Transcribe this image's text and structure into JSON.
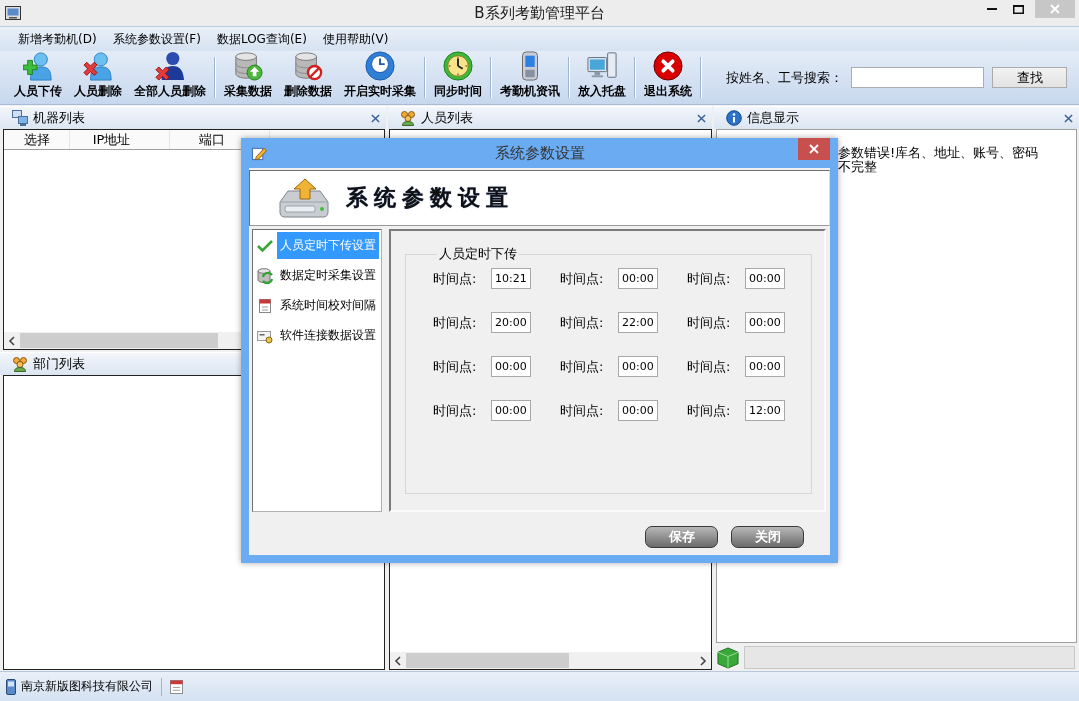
{
  "window": {
    "title": "B系列考勤管理平台"
  },
  "menu": [
    "新增考勤机(D)",
    "系统参数设置(F)",
    "数据LOG查询(E)",
    "使用帮助(V)"
  ],
  "toolbar": [
    {
      "items": [
        {
          "label": "人员下传",
          "kind": "adduser"
        },
        {
          "label": "人员删除",
          "kind": "deluser"
        },
        {
          "label": "全部人员删除",
          "kind": "delall"
        }
      ]
    },
    {
      "items": [
        {
          "label": "采集数据",
          "kind": "collect"
        },
        {
          "label": "删除数据",
          "kind": "erase"
        },
        {
          "label": "开启实时采集",
          "kind": "realtime"
        }
      ]
    },
    {
      "items": [
        {
          "label": "同步时间",
          "kind": "sync"
        }
      ]
    },
    {
      "items": [
        {
          "label": "考勤机资讯",
          "kind": "device"
        }
      ]
    },
    {
      "items": [
        {
          "label": "放入托盘",
          "kind": "tray"
        }
      ]
    },
    {
      "items": [
        {
          "label": "退出系统",
          "kind": "exit"
        }
      ]
    }
  ],
  "search": {
    "label": "按姓名、工号搜索：",
    "button": "查找"
  },
  "machine_list": {
    "title": "机器列表",
    "columns": [
      "选择",
      "IP地址",
      "端口"
    ]
  },
  "department_list": {
    "title": "部门列表"
  },
  "person_list": {
    "title": "人员列表"
  },
  "info_panel": {
    "title": "信息显示",
    "lines": [
      "参数错误!库名、地址、账号、密码",
      "不完整"
    ]
  },
  "status_bar": {
    "company": "南京新版图科技有限公司"
  },
  "dialog": {
    "title": "系统参数设置",
    "heading": "系统参数设置",
    "nav": [
      {
        "label": "人员定时下传设置",
        "kind": "check",
        "selected": true
      },
      {
        "label": "数据定时采集设置",
        "kind": "dbsync",
        "selected": false
      },
      {
        "label": "系统时间校对间隔",
        "kind": "calendar",
        "selected": false
      },
      {
        "label": "软件连接数据设置",
        "kind": "card",
        "selected": false
      }
    ],
    "group": {
      "title": "人员定时下传",
      "fields": [
        {
          "label": "时间点:",
          "value": "10:21"
        },
        {
          "label": "时间点:",
          "value": "00:00"
        },
        {
          "label": "时间点:",
          "value": "00:00"
        },
        {
          "label": "时间点:",
          "value": "20:00"
        },
        {
          "label": "时间点:",
          "value": "22:00"
        },
        {
          "label": "时间点:",
          "value": "00:00"
        },
        {
          "label": "时间点:",
          "value": "00:00"
        },
        {
          "label": "时间点:",
          "value": "00:00"
        },
        {
          "label": "时间点:",
          "value": "00:00"
        },
        {
          "label": "时间点:",
          "value": "00:00"
        },
        {
          "label": "时间点:",
          "value": "00:00"
        },
        {
          "label": "时间点:",
          "value": "12:00"
        }
      ]
    },
    "buttons": [
      "保存",
      "关闭"
    ]
  }
}
